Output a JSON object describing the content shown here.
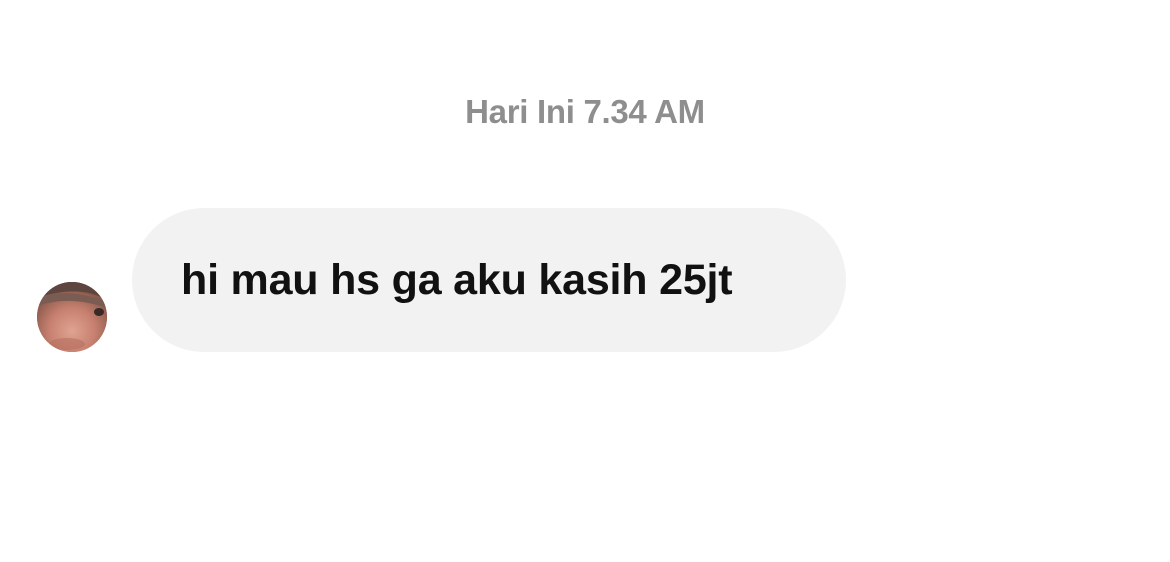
{
  "conversation": {
    "timestamp": "Hari Ini 7.34 AM",
    "messages": [
      {
        "sender": "other",
        "avatar_icon": "profile-photo",
        "text": "hi mau hs ga aku kasih 25jt"
      }
    ]
  },
  "colors": {
    "background": "#ffffff",
    "bubble_background": "#f2f2f2",
    "timestamp_text": "#8e8e8e",
    "message_text": "#111111"
  }
}
